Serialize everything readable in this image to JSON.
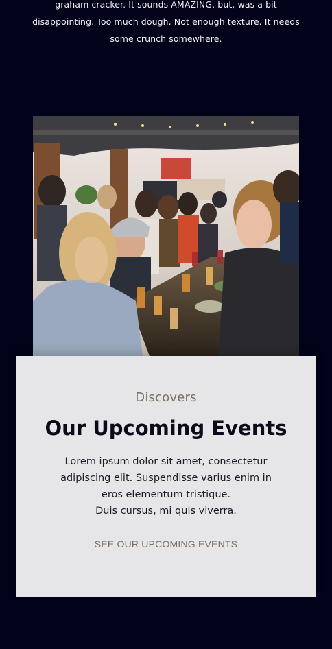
{
  "testimonial": {
    "lines": [
      "graham cracker. It sounds AMAZING, but, was a bit",
      "disappointing. Too much dough. Not enough texture. It needs",
      "some crunch somewhere."
    ]
  },
  "events": {
    "eyebrow": "Discovers",
    "title": "Our Upcoming Events",
    "description_lines": [
      "Lorem ipsum dolor sit amet, consectetur",
      "adipiscing elit. Suspendisse varius enim in",
      "eros elementum tristique.",
      "Duis cursus, mi quis viverra."
    ],
    "cta_label": "SEE OUR UPCOMING EVENTS"
  },
  "colors": {
    "page_background": "#02021a",
    "card_background": "#e6e6e8",
    "accent_muted": "#7b6e63",
    "heading": "#0b0b1a"
  }
}
